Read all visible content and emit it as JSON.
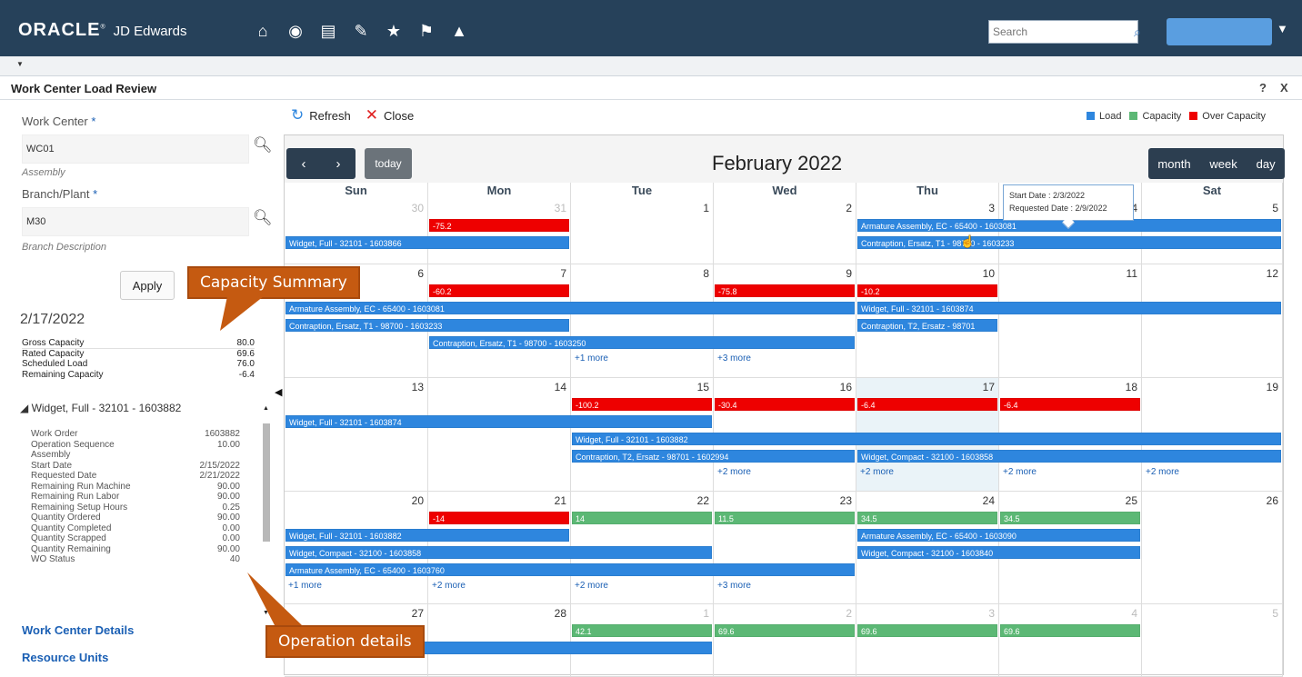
{
  "brand": {
    "oracle": "ORACLE",
    "product": "JD Edwards"
  },
  "nav_icons": [
    "home-icon",
    "compass-icon",
    "chart-icon",
    "edit-icon",
    "star-icon",
    "flag-icon",
    "bell-icon"
  ],
  "search": {
    "placeholder": "Search"
  },
  "page": {
    "title": "Work Center Load Review",
    "help": "?",
    "close": "X"
  },
  "filters": {
    "work_center_label": "Work Center",
    "work_center_value": "WC01",
    "work_center_desc": "Assembly",
    "branch_label": "Branch/Plant",
    "branch_value": "M30",
    "branch_desc": "Branch Description",
    "required_mark": "*",
    "apply": "Apply"
  },
  "summary": {
    "date": "2/17/2022",
    "rows": [
      {
        "label": "Gross Capacity",
        "value": "80.0"
      },
      {
        "label": "Rated Capacity",
        "value": "69.6"
      },
      {
        "label": "Scheduled Load",
        "value": "76.0"
      },
      {
        "label": "Remaining Capacity",
        "value": "-6.4"
      }
    ]
  },
  "operation": {
    "header": "Widget, Full - 32101 - 1603882",
    "rows": [
      {
        "label": "Work Order",
        "value": "1603882"
      },
      {
        "label": "Operation Sequence",
        "value": "10.00"
      },
      {
        "label": "Assembly",
        "value": ""
      },
      {
        "label": "Start Date",
        "value": "2/15/2022"
      },
      {
        "label": "Requested Date",
        "value": "2/21/2022"
      },
      {
        "label": "Remaining Run Machine",
        "value": "90.00"
      },
      {
        "label": "Remaining Run Labor",
        "value": "90.00"
      },
      {
        "label": "Remaining Setup Hours",
        "value": "0.25"
      },
      {
        "label": "Quantity Ordered",
        "value": "90.00"
      },
      {
        "label": "Quantity Completed",
        "value": "0.00"
      },
      {
        "label": "Quantity Scrapped",
        "value": "0.00"
      },
      {
        "label": "Quantity Remaining",
        "value": "90.00"
      },
      {
        "label": "WO Status",
        "value": "40"
      }
    ]
  },
  "links": {
    "work_center_details": "Work Center Details",
    "resource_units": "Resource Units"
  },
  "callouts": {
    "capacity_summary": "Capacity Summary",
    "operation_details": "Operation details"
  },
  "toolbar": {
    "refresh": "Refresh",
    "close": "Close"
  },
  "legend": [
    {
      "label": "Load",
      "color": "#2e86de"
    },
    {
      "label": "Capacity",
      "color": "#5cb875"
    },
    {
      "label": "Over Capacity",
      "color": "#ee0000"
    }
  ],
  "calendar": {
    "title": "February 2022",
    "prev": "‹",
    "next": "›",
    "today": "today",
    "views": [
      "month",
      "week",
      "day"
    ],
    "weekdays": [
      "Sun",
      "Mon",
      "Tue",
      "Wed",
      "Thu",
      "Fri",
      "Sat"
    ],
    "weeks": [
      [
        "30",
        "31",
        "1",
        "2",
        "3",
        "4",
        "5"
      ],
      [
        "6",
        "7",
        "8",
        "9",
        "10",
        "11",
        "12"
      ],
      [
        "13",
        "14",
        "15",
        "16",
        "17",
        "18",
        "19"
      ],
      [
        "20",
        "21",
        "22",
        "23",
        "24",
        "25",
        "26"
      ],
      [
        "27",
        "28",
        "1",
        "2",
        "3",
        "4",
        "5"
      ]
    ],
    "tooltip": {
      "start": "Start Date : 2/3/2022",
      "requested": "Requested Date : 2/9/2022"
    },
    "events": [
      {
        "w": 0,
        "d": 1,
        "span": 1,
        "lane": 0,
        "type": "over",
        "label": "-75.2"
      },
      {
        "w": 0,
        "d": 0,
        "span": 2,
        "lane": 1,
        "type": "load",
        "label": "Widget, Full - 32101 - 1603866"
      },
      {
        "w": 0,
        "d": 4,
        "span": 3,
        "lane": 0,
        "type": "load",
        "label": "Armature Assembly, EC - 65400 - 1603081"
      },
      {
        "w": 0,
        "d": 4,
        "span": 3,
        "lane": 1,
        "type": "load",
        "label": "Contraption, Ersatz, T1 - 98700 - 1603233"
      },
      {
        "w": 1,
        "d": 1,
        "span": 1,
        "lane": 0,
        "type": "over",
        "label": "-60.2"
      },
      {
        "w": 1,
        "d": 3,
        "span": 1,
        "lane": 0,
        "type": "over",
        "label": "-75.8"
      },
      {
        "w": 1,
        "d": 4,
        "span": 1,
        "lane": 0,
        "type": "over",
        "label": "-10.2"
      },
      {
        "w": 1,
        "d": 0,
        "span": 4,
        "lane": 1,
        "type": "load",
        "label": "Armature Assembly, EC - 65400 - 1603081"
      },
      {
        "w": 1,
        "d": 4,
        "span": 3,
        "lane": 1,
        "type": "load",
        "label": "Widget, Full - 32101 - 1603874"
      },
      {
        "w": 1,
        "d": 0,
        "span": 2,
        "lane": 2,
        "type": "load",
        "label": "Contraption, Ersatz, T1 - 98700 - 1603233"
      },
      {
        "w": 1,
        "d": 4,
        "span": 1,
        "lane": 2,
        "type": "load",
        "label": "Contraption, T2, Ersatz - 98701"
      },
      {
        "w": 1,
        "d": 1,
        "span": 3,
        "lane": 3,
        "type": "load",
        "label": "Contraption, Ersatz, T1 - 98700 - 1603250"
      },
      {
        "w": 2,
        "d": 2,
        "span": 1,
        "lane": 0,
        "type": "over",
        "label": "-100.2"
      },
      {
        "w": 2,
        "d": 3,
        "span": 1,
        "lane": 0,
        "type": "over",
        "label": "-30.4"
      },
      {
        "w": 2,
        "d": 4,
        "span": 1,
        "lane": 0,
        "type": "over",
        "label": "-6.4"
      },
      {
        "w": 2,
        "d": 5,
        "span": 1,
        "lane": 0,
        "type": "over",
        "label": "-6.4"
      },
      {
        "w": 2,
        "d": 0,
        "span": 3,
        "lane": 1,
        "type": "load",
        "label": "Widget, Full - 32101 - 1603874"
      },
      {
        "w": 2,
        "d": 2,
        "span": 5,
        "lane": 2,
        "type": "load",
        "label": "Widget, Full - 32101 - 1603882"
      },
      {
        "w": 2,
        "d": 2,
        "span": 2,
        "lane": 3,
        "type": "load",
        "label": "Contraption, T2, Ersatz - 98701 - 1602994"
      },
      {
        "w": 2,
        "d": 4,
        "span": 3,
        "lane": 3,
        "type": "load",
        "label": "Widget, Compact - 32100 - 1603858"
      },
      {
        "w": 3,
        "d": 1,
        "span": 1,
        "lane": 0,
        "type": "over",
        "label": "-14"
      },
      {
        "w": 3,
        "d": 2,
        "span": 1,
        "lane": 0,
        "type": "cap",
        "label": "14"
      },
      {
        "w": 3,
        "d": 3,
        "span": 1,
        "lane": 0,
        "type": "cap",
        "label": "11.5"
      },
      {
        "w": 3,
        "d": 4,
        "span": 1,
        "lane": 0,
        "type": "cap",
        "label": "34.5"
      },
      {
        "w": 3,
        "d": 5,
        "span": 1,
        "lane": 0,
        "type": "cap",
        "label": "34.5"
      },
      {
        "w": 3,
        "d": 0,
        "span": 2,
        "lane": 1,
        "type": "load",
        "label": "Widget, Full - 32101 - 1603882"
      },
      {
        "w": 3,
        "d": 4,
        "span": 2,
        "lane": 1,
        "type": "load",
        "label": "Armature Assembly, EC - 65400 - 1603090"
      },
      {
        "w": 3,
        "d": 0,
        "span": 3,
        "lane": 2,
        "type": "load",
        "label": "Widget, Compact - 32100 - 1603858"
      },
      {
        "w": 3,
        "d": 4,
        "span": 2,
        "lane": 2,
        "type": "load",
        "label": "Widget, Compact - 32100 - 1603840"
      },
      {
        "w": 3,
        "d": 0,
        "span": 4,
        "lane": 3,
        "type": "load",
        "label": "Armature Assembly, EC - 65400 - 1603760"
      },
      {
        "w": 4,
        "d": 2,
        "span": 1,
        "lane": 0,
        "type": "cap",
        "label": "42.1"
      },
      {
        "w": 4,
        "d": 3,
        "span": 1,
        "lane": 0,
        "type": "cap",
        "label": "69.6"
      },
      {
        "w": 4,
        "d": 4,
        "span": 1,
        "lane": 0,
        "type": "cap",
        "label": "69.6"
      },
      {
        "w": 4,
        "d": 5,
        "span": 1,
        "lane": 0,
        "type": "cap",
        "label": "69.6"
      },
      {
        "w": 4,
        "d": 0,
        "span": 3,
        "lane": 1,
        "type": "load",
        "label": ""
      }
    ],
    "more": [
      {
        "w": 1,
        "d": 2,
        "label": "+1 more"
      },
      {
        "w": 1,
        "d": 3,
        "label": "+3 more"
      },
      {
        "w": 2,
        "d": 3,
        "label": "+2 more"
      },
      {
        "w": 2,
        "d": 4,
        "label": "+2 more"
      },
      {
        "w": 2,
        "d": 5,
        "label": "+2 more"
      },
      {
        "w": 2,
        "d": 6,
        "label": "+2 more"
      },
      {
        "w": 3,
        "d": 0,
        "label": "+1 more"
      },
      {
        "w": 3,
        "d": 1,
        "label": "+2 more"
      },
      {
        "w": 3,
        "d": 2,
        "label": "+2 more"
      },
      {
        "w": 3,
        "d": 3,
        "label": "+3 more"
      }
    ]
  }
}
